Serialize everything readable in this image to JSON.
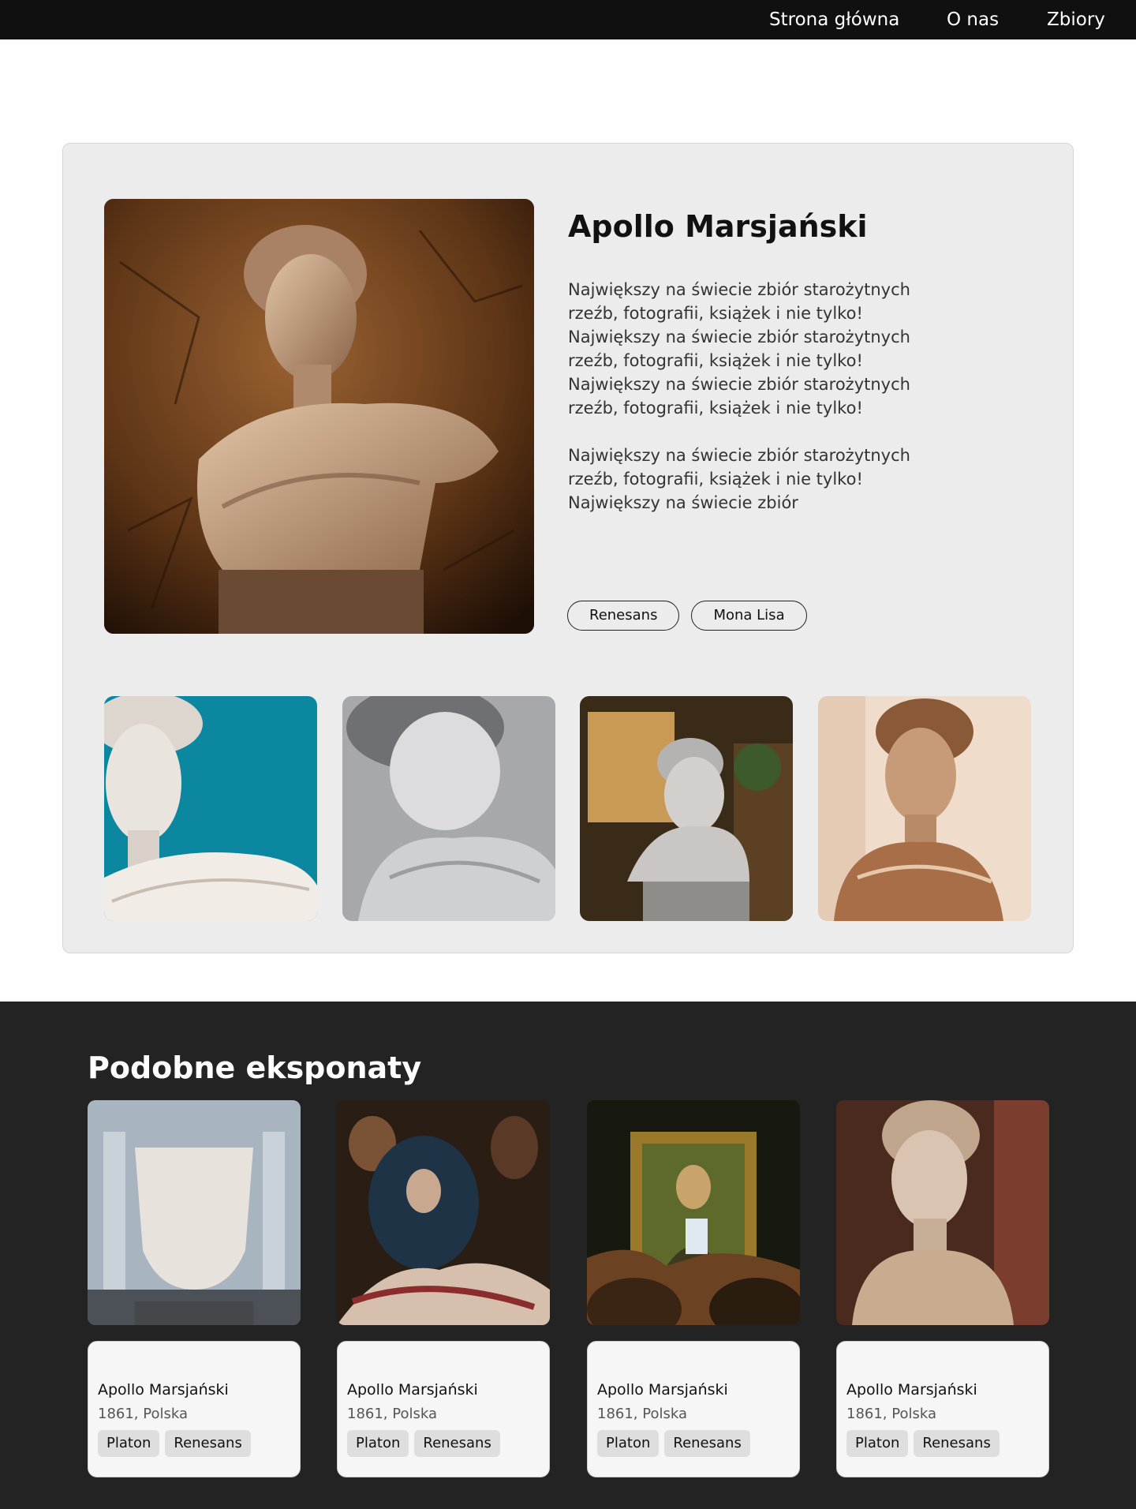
{
  "nav": {
    "items": [
      {
        "label": "Strona główna"
      },
      {
        "label": "O nas"
      },
      {
        "label": "Zbiory"
      }
    ]
  },
  "detail": {
    "title": "Apollo Marsjański",
    "paragraphs": [
      "Największy na świecie zbiór starożytnych rzeźb, fotografii, książek i nie tylko! Największy na świecie zbiór starożytnych rzeźb, fotografii, książek i nie tylko! Największy na świecie zbiór starożytnych rzeźb, fotografii, książek i nie tylko!",
      "Największy na świecie zbiór starożytnych rzeźb, fotografii, książek i nie tylko! Największy na świecie zbiór"
    ],
    "tags": [
      "Renesans",
      "Mona Lisa"
    ]
  },
  "similar": {
    "title": "Podobne eksponaty",
    "items": [
      {
        "name": "Apollo Marsjański",
        "meta": "1861, Polska",
        "tags": [
          "Platon",
          "Renesans"
        ]
      },
      {
        "name": "Apollo Marsjański",
        "meta": "1861, Polska",
        "tags": [
          "Platon",
          "Renesans"
        ]
      },
      {
        "name": "Apollo Marsjański",
        "meta": "1861, Polska",
        "tags": [
          "Platon",
          "Renesans"
        ]
      },
      {
        "name": "Apollo Marsjański",
        "meta": "1861, Polska",
        "tags": [
          "Platon",
          "Renesans"
        ]
      }
    ]
  },
  "colors": {
    "nav_bg": "#101010",
    "card_bg": "#ececec",
    "dark_section_bg": "#232323",
    "chip_bg": "#dedede"
  }
}
